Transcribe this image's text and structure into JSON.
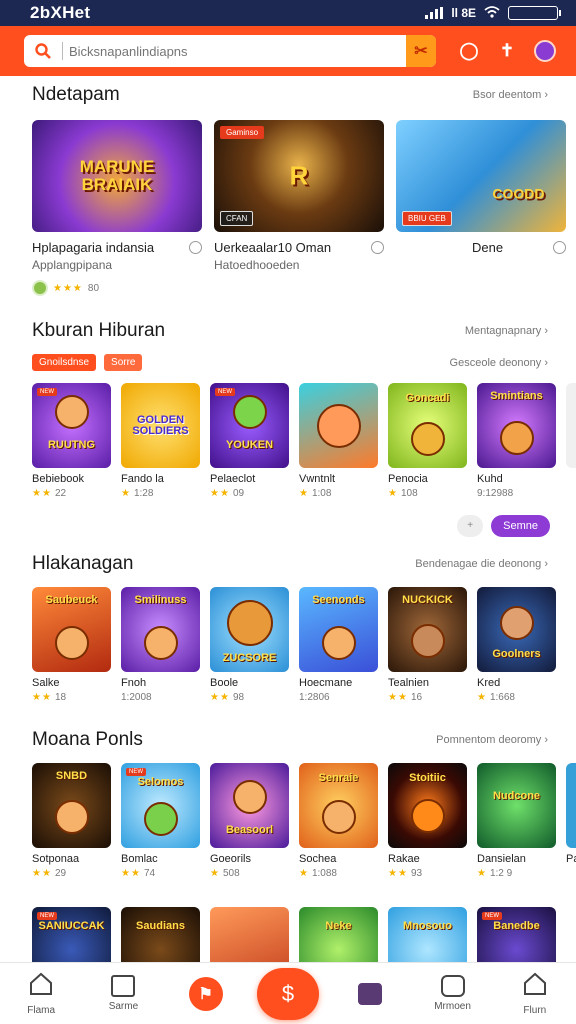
{
  "status_bar": {
    "brand": "2bXHet",
    "time_text": "ll 8E"
  },
  "header": {
    "search_placeholder": "Bicksnapanlindiapns"
  },
  "section1": {
    "title": "Ndetapam",
    "link": "Bsor deentom ›",
    "cards": [
      {
        "title": "Hplapagaria indansia",
        "subtitle": "Applangpipana",
        "badge": "",
        "tag": "",
        "art": "MARUNE BRAIAIK",
        "bg": "#5a2aa0"
      },
      {
        "title": "Uerkeaalar10 Oman",
        "subtitle": "Hatoedhooeden",
        "badge": "Gaminso",
        "tag": "CFAN",
        "art": "R",
        "bg": "#3b2a16"
      },
      {
        "title": "Dene",
        "subtitle": "",
        "badge": "",
        "tag": "BBIU GEB",
        "art": "COODD",
        "bg": "#4aa8e8"
      }
    ],
    "rating_value": "80"
  },
  "section2": {
    "title": "Kburan Hiburan",
    "link": "Mentagnapnary ›",
    "chips": [
      "Gnoilsdnse",
      "Sorre"
    ],
    "chips_link": "Gesceole deonony ›",
    "tiles": [
      {
        "name": "Bebiebook",
        "rating": "22",
        "art": "RUUTNG",
        "bg": "#8a3ad1"
      },
      {
        "name": "Fando la",
        "rating": "1:28",
        "art": "GOLDEN SOLDIERS",
        "bg": "#f7c531"
      },
      {
        "name": "Pelaeclot",
        "rating": "09",
        "art": "YOUKEN",
        "bg": "#6a2db8"
      },
      {
        "name": "Vwntnlt",
        "rating": "1:08",
        "art": "",
        "bg": "#2bb0c8"
      },
      {
        "name": "Penocia",
        "rating": "108",
        "art": "Goncadi",
        "bg": "#9ccc3d"
      },
      {
        "name": "Kuhd",
        "rating": "9:12988",
        "art": "Smintians",
        "bg": "#6b2aa6"
      },
      {
        "name": "",
        "rating": "",
        "art": "",
        "bg": "#e0e0e0"
      }
    ],
    "more_ghost": "+",
    "more_label": "Semne"
  },
  "section3": {
    "title": "Hlakanagan",
    "link": "Bendenagae die deonong ›",
    "tiles": [
      {
        "name": "Salke",
        "rating": "18",
        "art": "Saubeuck",
        "bg": "#d94c1a"
      },
      {
        "name": "Fnoh",
        "rating": "1:2008",
        "art": "Smilinuss",
        "bg": "#7c3ad8"
      },
      {
        "name": "Boole",
        "rating": "98",
        "art": "ZUCSORE",
        "bg": "#2b9fd6"
      },
      {
        "name": "Hoecmane",
        "rating": "1:2806",
        "art": "Seenonds",
        "bg": "#3a7ad8"
      },
      {
        "name": "Tealnien",
        "rating": "16",
        "art": "NUCKICK",
        "bg": "#4a2f1a"
      },
      {
        "name": "Kred",
        "rating": "1:668",
        "art": "Goolners",
        "bg": "#1e2e55"
      }
    ]
  },
  "section4": {
    "title": "Moana Ponls",
    "link": "Pomnentom deoromy ›",
    "tiles": [
      {
        "name": "Sotponaa",
        "rating": "29",
        "art": "SNBD",
        "bg": "#3a2512"
      },
      {
        "name": "Bomlac",
        "rating": "74",
        "art": "Selomos",
        "bg": "#33a7d9"
      },
      {
        "name": "Goeorils",
        "rating": "508",
        "art": "Beasoorl",
        "bg": "#6a2db8"
      },
      {
        "name": "Sochea",
        "rating": "1:088",
        "art": "Senraie",
        "bg": "#f08a2a"
      },
      {
        "name": "Rakae",
        "rating": "93",
        "art": "Stoitiic",
        "bg": "#1a1a1a"
      },
      {
        "name": "Dansielan",
        "rating": "1:2 9",
        "art": "Nudcone",
        "bg": "#1f7a3a"
      },
      {
        "name": "Pan",
        "rating": "",
        "art": "",
        "bg": "#35a0d8"
      }
    ]
  },
  "section5": {
    "tiles": [
      {
        "art": "SANIUCCAK",
        "bg": "#1b2a5a",
        "name": ""
      },
      {
        "art": "Saudians",
        "bg": "#2b1a0e",
        "name": ""
      },
      {
        "art": "",
        "bg": "#d94c1a",
        "name": ""
      },
      {
        "art": "Neke",
        "bg": "#3fa33a",
        "name": ""
      },
      {
        "art": "Mnosouo",
        "bg": "#37a3e0",
        "name": ""
      },
      {
        "art": "Banedbe",
        "bg": "#2a1e4e",
        "name": ""
      }
    ]
  },
  "bottom_nav": {
    "items": [
      {
        "label": "Flama"
      },
      {
        "label": "Sarme"
      },
      {
        "label": ""
      },
      {
        "label": ""
      },
      {
        "label": ""
      },
      {
        "label": "Mrmoen"
      },
      {
        "label": "Flurn"
      }
    ],
    "center_icon": "$"
  },
  "colors": {
    "primary": "#ff4f1f",
    "status_bar": "#1c2752",
    "purple": "#8e3bd6",
    "star": "#f5b400"
  }
}
